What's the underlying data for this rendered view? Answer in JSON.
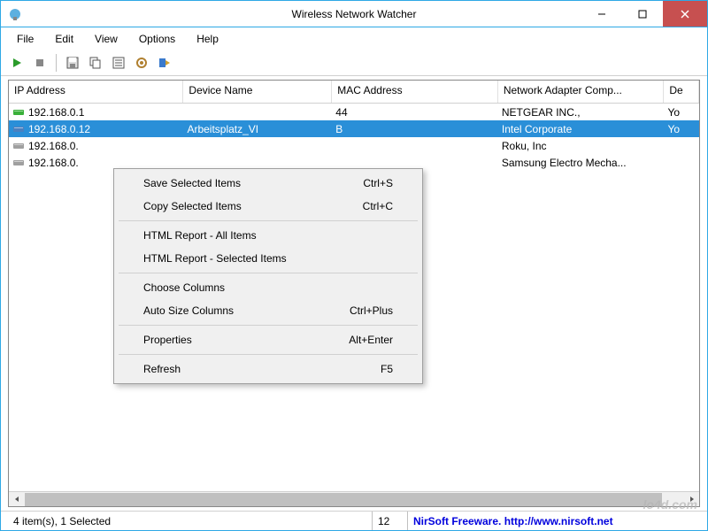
{
  "window": {
    "title": "Wireless Network Watcher"
  },
  "menu": {
    "file": "File",
    "edit": "Edit",
    "view": "View",
    "options": "Options",
    "help": "Help"
  },
  "columns": {
    "ip": "IP Address",
    "device": "Device Name",
    "mac": "MAC Address",
    "adapter": "Network Adapter Comp...",
    "dev2": "De"
  },
  "rows": [
    {
      "ip": "192.168.0.1",
      "device": "",
      "mac": "44",
      "adapter": "NETGEAR INC.,",
      "dev2": "Yo",
      "selected": false,
      "icon": "green"
    },
    {
      "ip": "192.168.0.12",
      "device": "Arbeitsplatz_VI",
      "mac": "B",
      "adapter": "Intel Corporate",
      "dev2": "Yo",
      "selected": true,
      "icon": "blue"
    },
    {
      "ip": "192.168.0.",
      "device": "",
      "mac": "",
      "adapter": "Roku, Inc",
      "dev2": "",
      "selected": false,
      "icon": "gray"
    },
    {
      "ip": "192.168.0.",
      "device": "",
      "mac": "",
      "adapter": "Samsung Electro Mecha...",
      "dev2": "",
      "selected": false,
      "icon": "gray"
    }
  ],
  "context_menu": [
    {
      "label": "Save Selected Items",
      "shortcut": "Ctrl+S"
    },
    {
      "label": "Copy Selected Items",
      "shortcut": "Ctrl+C"
    },
    {
      "sep": true
    },
    {
      "label": "HTML Report - All Items",
      "shortcut": ""
    },
    {
      "label": "HTML Report - Selected Items",
      "shortcut": ""
    },
    {
      "sep": true
    },
    {
      "label": "Choose Columns",
      "shortcut": ""
    },
    {
      "label": "Auto Size Columns",
      "shortcut": "Ctrl+Plus"
    },
    {
      "sep": true
    },
    {
      "label": "Properties",
      "shortcut": "Alt+Enter"
    },
    {
      "sep": true
    },
    {
      "label": "Refresh",
      "shortcut": "F5"
    }
  ],
  "status": {
    "items": "4 item(s), 1 Selected",
    "count": "12",
    "link_text": "NirSoft Freeware.  http://www.nirsoft.net"
  },
  "watermark": "lo4d.com"
}
